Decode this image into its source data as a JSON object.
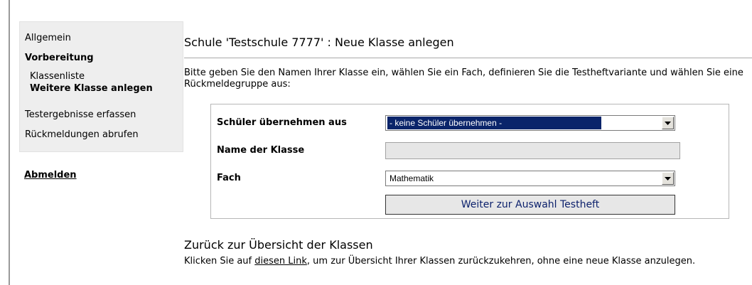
{
  "sidebar": {
    "items": [
      {
        "label": "Allgemein"
      },
      {
        "label": "Vorbereitung"
      },
      {
        "label": "Klassenliste"
      },
      {
        "label": "Weitere Klasse anlegen"
      },
      {
        "label": "Testergebnisse erfassen"
      },
      {
        "label": "Rückmeldungen abrufen"
      }
    ],
    "logout_label": "Abmelden"
  },
  "main": {
    "title": "Schule 'Testschule 7777' : Neue Klasse anlegen",
    "intro": "Bitte geben Sie den Namen Ihrer Klasse ein, wählen Sie ein Fach, definieren Sie die Testheftvariante und wählen Sie eine Rückmeldegruppe aus:"
  },
  "form": {
    "students_label": "Schüler übernehmen aus",
    "students_value": "- keine Schüler übernehmen -",
    "class_name_label": "Name der Klasse",
    "class_name_value": "",
    "subject_label": "Fach",
    "subject_value": "Mathematik",
    "submit_label": "Weiter zur Auswahl Testheft"
  },
  "back": {
    "title": "Zurück zur Übersicht der Klassen",
    "text_before": "Klicken Sie auf ",
    "link_label": "diesen Link",
    "text_after": ", um zur Übersicht Ihrer Klassen zurückzukehren, ohne eine neue Klasse anzulegen."
  }
}
